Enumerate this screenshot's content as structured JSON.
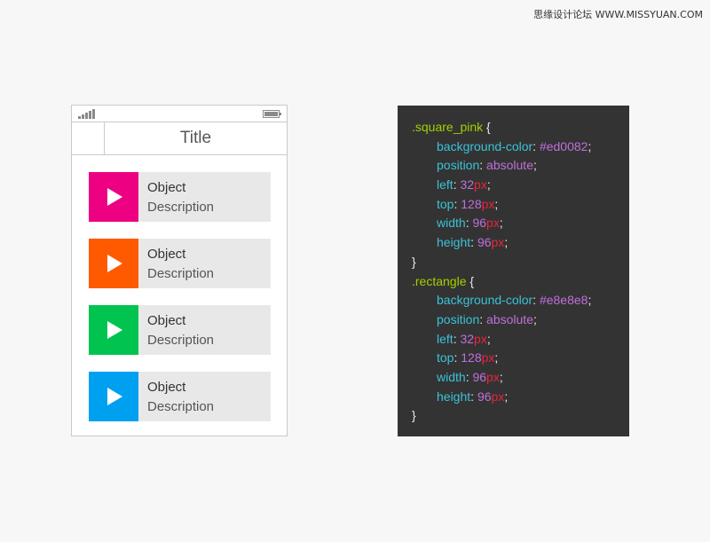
{
  "watermark": "思缘设计论坛 WWW.MISSYUAN.COM",
  "phone": {
    "title": "Title",
    "items": [
      {
        "title": "Object",
        "description": "Description",
        "color": "#ed0082"
      },
      {
        "title": "Object",
        "description": "Description",
        "color": "#ff5a00"
      },
      {
        "title": "Object",
        "description": "Description",
        "color": "#00c44f"
      },
      {
        "title": "Object",
        "description": "Description",
        "color": "#00a0f0"
      }
    ]
  },
  "code": {
    "blocks": [
      {
        "selector": ".square_pink",
        "open": " {",
        "close": "}",
        "props": [
          {
            "name": "background-color",
            "value": "#ed0082",
            "unit": ""
          },
          {
            "name": "position",
            "value": "absolute",
            "unit": ""
          },
          {
            "name": "left",
            "value": "32",
            "unit": "px"
          },
          {
            "name": "top",
            "value": "128",
            "unit": "px"
          },
          {
            "name": "width",
            "value": "96",
            "unit": "px"
          },
          {
            "name": "height",
            "value": "96",
            "unit": "px"
          }
        ]
      },
      {
        "selector": ".rectangle",
        "open": " {",
        "close": "}",
        "props": [
          {
            "name": "background-color",
            "value": "#e8e8e8",
            "unit": ""
          },
          {
            "name": "position",
            "value": "absolute",
            "unit": ""
          },
          {
            "name": "left",
            "value": "32",
            "unit": "px"
          },
          {
            "name": "top",
            "value": "128",
            "unit": "px"
          },
          {
            "name": "width",
            "value": "96",
            "unit": "px"
          },
          {
            "name": "height",
            "value": "96",
            "unit": "px"
          }
        ]
      }
    ]
  },
  "icons": {
    "signal": "signal-strength-icon",
    "battery": "battery-icon",
    "play": "play-icon"
  }
}
